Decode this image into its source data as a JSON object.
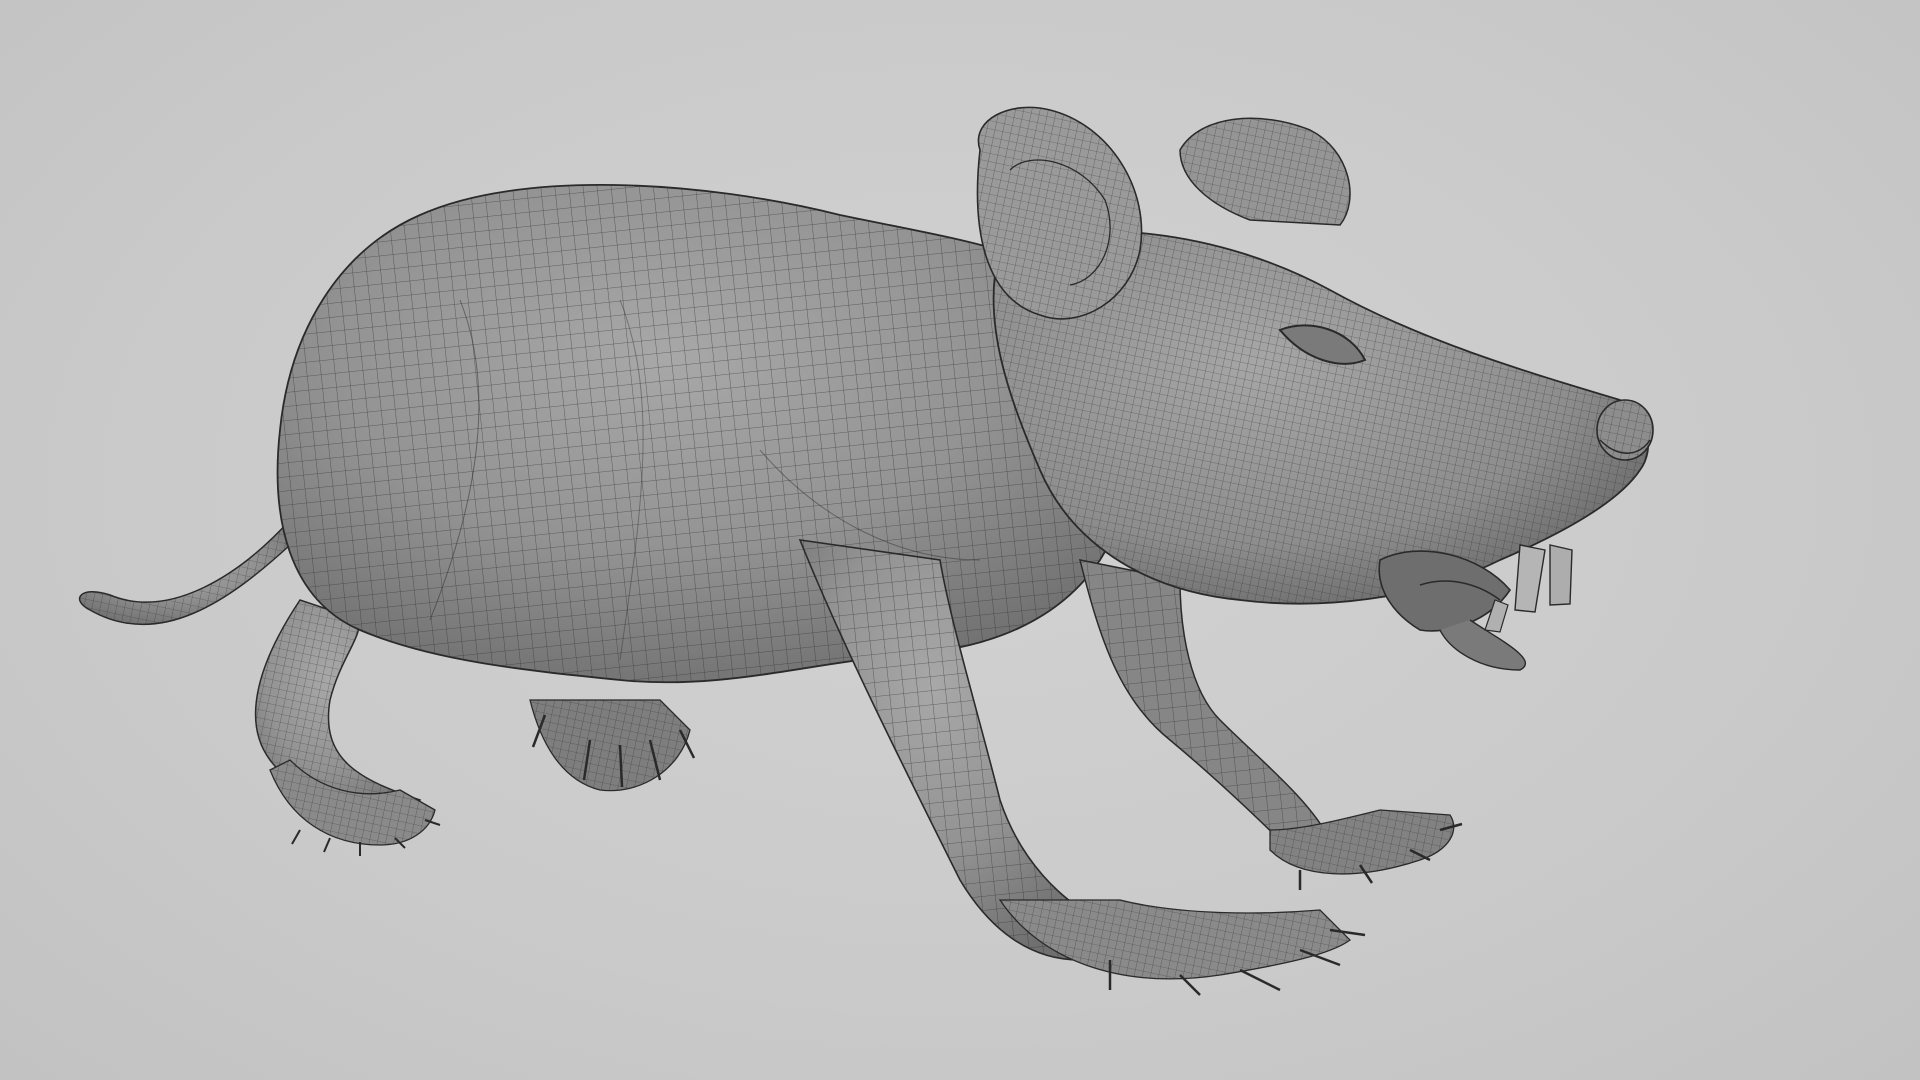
{
  "viewport": {
    "background_color": "#cacaca",
    "mesh_fill_color": "#8e8e8e",
    "wire_color": "#2a2a2a",
    "subject": "rat-wireframe-mesh"
  }
}
